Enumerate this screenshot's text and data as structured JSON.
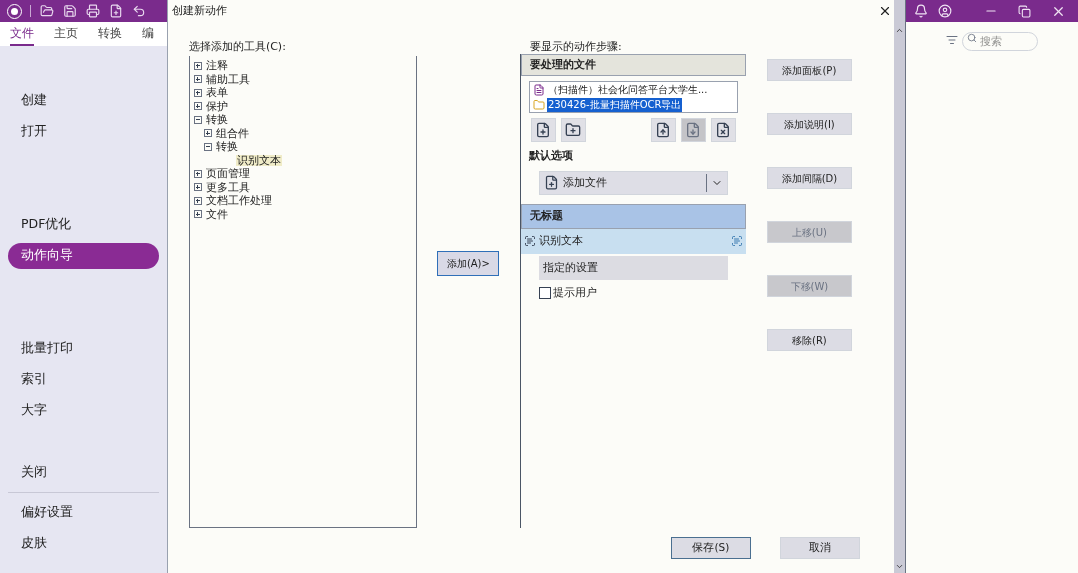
{
  "app": {
    "tabs": [
      {
        "label": "文件",
        "selected": true
      },
      {
        "label": "主页",
        "selected": false
      },
      {
        "label": "转换",
        "selected": false
      },
      {
        "label": "编",
        "selected": false
      }
    ],
    "menu": [
      {
        "kind": "faded"
      },
      {
        "kind": "item",
        "label": "创建",
        "selected": false
      },
      {
        "kind": "item",
        "label": "打开",
        "selected": false
      },
      {
        "kind": "faded"
      },
      {
        "kind": "faded"
      },
      {
        "kind": "item",
        "label": "PDF优化",
        "selected": false
      },
      {
        "kind": "item",
        "label": "动作向导",
        "selected": true
      },
      {
        "kind": "faded"
      },
      {
        "kind": "faded"
      },
      {
        "kind": "item",
        "label": "批量打印",
        "selected": false
      },
      {
        "kind": "item",
        "label": "索引",
        "selected": false
      },
      {
        "kind": "item",
        "label": "大字",
        "selected": false
      },
      {
        "kind": "faded"
      },
      {
        "kind": "item",
        "label": "关闭",
        "selected": false
      },
      {
        "kind": "divider"
      },
      {
        "kind": "item",
        "label": "偏好设置",
        "selected": false
      },
      {
        "kind": "item",
        "label": "皮肤",
        "selected": false
      }
    ],
    "search": {
      "placeholder": "搜索"
    }
  },
  "dialog": {
    "title": "创建新动作",
    "tools_label": "选择添加的工具(C):",
    "tools": [
      {
        "label": "注释",
        "expanded": false,
        "selected": false
      },
      {
        "label": "辅助工具",
        "expanded": false,
        "selected": false
      },
      {
        "label": "表单",
        "expanded": false,
        "selected": false
      },
      {
        "label": "保护",
        "expanded": false,
        "selected": false
      },
      {
        "label": "转换",
        "expanded": true,
        "selected": false,
        "children": [
          {
            "label": "组合件",
            "expanded": false,
            "selected": false
          },
          {
            "label": "转换",
            "expanded": true,
            "selected": false,
            "children": [
              {
                "label": "识别文本",
                "selected": true
              }
            ]
          }
        ]
      },
      {
        "label": "页面管理",
        "expanded": false,
        "selected": false
      },
      {
        "label": "更多工具",
        "expanded": false,
        "selected": false
      },
      {
        "label": "文档工作处理",
        "expanded": false,
        "selected": false
      },
      {
        "label": "文件",
        "expanded": false,
        "selected": false
      }
    ],
    "add_button": "添加(A)>",
    "steps_label": "要显示的动作步骤:",
    "files_header": "要处理的文件",
    "files": [
      {
        "kind": "pdf",
        "name": "（扫描件）社会化问答平台大学生...",
        "selected": false
      },
      {
        "kind": "folder",
        "name": "230426-批量扫描件OCR导出",
        "selected": true
      }
    ],
    "file_tools": [
      {
        "kind": "add-file",
        "disabled": false
      },
      {
        "kind": "add-folder",
        "disabled": false
      },
      {
        "kind": "move-up",
        "disabled": false
      },
      {
        "kind": "move-down",
        "disabled": true
      },
      {
        "kind": "remove",
        "disabled": false
      }
    ],
    "default_label": "默认选项",
    "default_option": "添加文件",
    "step_group": "无标题",
    "step": "识别文本",
    "step_settings": "指定的设置",
    "prompt": {
      "label": "提示用户",
      "checked": false
    },
    "side_buttons": [
      {
        "label": "添加面板(P)",
        "disabled": false
      },
      {
        "label": "添加说明(I)",
        "disabled": false
      },
      {
        "label": "添加间隔(D)",
        "disabled": false
      },
      {
        "label": "上移(U)",
        "disabled": true
      },
      {
        "label": "下移(W)",
        "disabled": true
      },
      {
        "label": "移除(R)",
        "disabled": false
      }
    ],
    "save": "保存(S)",
    "cancel": "取消"
  }
}
